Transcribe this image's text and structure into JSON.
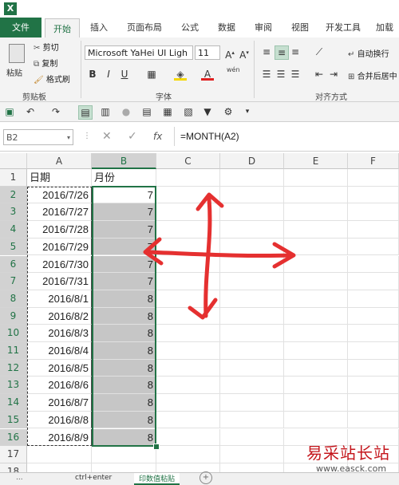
{
  "title_bar": {
    "app_icon": "excel-icon"
  },
  "tabs": {
    "file": "文件",
    "home": "开始",
    "insert": "插入",
    "page_layout": "页面布局",
    "formulas": "公式",
    "data": "数据",
    "review": "审阅",
    "view": "视图",
    "developer": "开发工具",
    "addins": "加载"
  },
  "clipboard": {
    "paste": "粘贴",
    "cut": "剪切",
    "copy": "复制",
    "format_painter": "格式刷",
    "group_label": "剪贴板"
  },
  "font": {
    "font_name": "Microsoft YaHei UI Ligh",
    "font_size": "11",
    "bold": "B",
    "italic": "I",
    "underline": "U",
    "font_color_letter": "A",
    "phonetic": "wén",
    "group_label": "字体"
  },
  "alignment": {
    "wrap_text": "自动换行",
    "merge_center": "合并后居中",
    "group_label": "对齐方式"
  },
  "formula_bar": {
    "name_box": "B2",
    "fx": "fx",
    "formula": "=MONTH(A2)"
  },
  "columns": [
    "A",
    "B",
    "C",
    "D",
    "E",
    "F"
  ],
  "rows": [
    {
      "n": "1",
      "a": "日期",
      "b": "月份"
    },
    {
      "n": "2",
      "a": "2016/7/26",
      "b": "7"
    },
    {
      "n": "3",
      "a": "2016/7/27",
      "b": "7"
    },
    {
      "n": "4",
      "a": "2016/7/28",
      "b": "7"
    },
    {
      "n": "5",
      "a": "2016/7/29",
      "b": "7"
    },
    {
      "n": "6",
      "a": "2016/7/30",
      "b": "7"
    },
    {
      "n": "7",
      "a": "2016/7/31",
      "b": "7"
    },
    {
      "n": "8",
      "a": "2016/8/1",
      "b": "8"
    },
    {
      "n": "9",
      "a": "2016/8/2",
      "b": "8"
    },
    {
      "n": "10",
      "a": "2016/8/3",
      "b": "8"
    },
    {
      "n": "11",
      "a": "2016/8/4",
      "b": "8"
    },
    {
      "n": "12",
      "a": "2016/8/5",
      "b": "8"
    },
    {
      "n": "13",
      "a": "2016/8/6",
      "b": "8"
    },
    {
      "n": "14",
      "a": "2016/8/7",
      "b": "8"
    },
    {
      "n": "15",
      "a": "2016/8/8",
      "b": "8"
    },
    {
      "n": "16",
      "a": "2016/8/9",
      "b": "8"
    },
    {
      "n": "17",
      "a": "",
      "b": ""
    },
    {
      "n": "18",
      "a": "",
      "b": ""
    }
  ],
  "sheet_tabs": [
    "...",
    "ctrl+enter",
    "印数值粘贴"
  ],
  "watermark": {
    "brand": "易采站长站",
    "url": "www.easck.com"
  },
  "colors": {
    "excel_green": "#217346",
    "selection_gray": "#c6c6c6",
    "arrow_red": "#e53030",
    "watermark_red": "#c4161c"
  }
}
